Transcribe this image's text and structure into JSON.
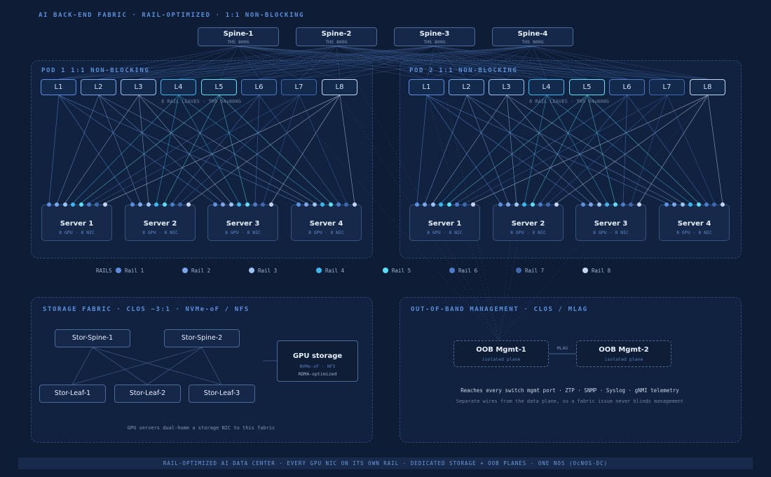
{
  "header": {
    "title": "AI BACK-END FABRIC · RAIL-OPTIMIZED · 1:1 NON-BLOCKING"
  },
  "spines": [
    {
      "name": "Spine-1",
      "model": "TH5 800G"
    },
    {
      "name": "Spine-2",
      "model": "TH5 800G"
    },
    {
      "name": "Spine-3",
      "model": "TH5 800G"
    },
    {
      "name": "Spine-4",
      "model": "TH5 800G"
    }
  ],
  "pods": [
    {
      "title": "POD 1 1:1 NON-BLOCKING",
      "caption": "8 RAIL LEAVES · TH5 64x800G",
      "leaves": [
        "L1",
        "L2",
        "L3",
        "L4",
        "L5",
        "L6",
        "L7",
        "L8"
      ],
      "servers": [
        {
          "name": "Server 1",
          "spec": "8 GPU · 8 NIC"
        },
        {
          "name": "Server 2",
          "spec": "8 GPU · 8 NIC"
        },
        {
          "name": "Server 3",
          "spec": "8 GPU · 8 NIC"
        },
        {
          "name": "Server 4",
          "spec": "8 GPU · 8 NIC"
        }
      ]
    },
    {
      "title": "POD 2 1:1 NON-BLOCKING",
      "caption": "8 RAIL LEAVES · TH5 64x800G",
      "leaves": [
        "L1",
        "L2",
        "L3",
        "L4",
        "L5",
        "L6",
        "L7",
        "L8"
      ],
      "servers": [
        {
          "name": "Server 1",
          "spec": "8 GPU · 8 NIC"
        },
        {
          "name": "Server 2",
          "spec": "8 GPU · 8 NIC"
        },
        {
          "name": "Server 3",
          "spec": "8 GPU · 8 NIC"
        },
        {
          "name": "Server 4",
          "spec": "8 GPU · 8 NIC"
        }
      ]
    }
  ],
  "legend": {
    "label": "RAILS",
    "rails": [
      {
        "name": "Rail 1",
        "color": "#5b8fe0"
      },
      {
        "name": "Rail 2",
        "color": "#7ba6ea"
      },
      {
        "name": "Rail 3",
        "color": "#9cc3f2"
      },
      {
        "name": "Rail 4",
        "color": "#3cb8ee"
      },
      {
        "name": "Rail 5",
        "color": "#5de0f5"
      },
      {
        "name": "Rail 6",
        "color": "#4c7cc9"
      },
      {
        "name": "Rail 7",
        "color": "#3d68ad"
      },
      {
        "name": "Rail 8",
        "color": "#c4d6f2"
      }
    ]
  },
  "storage": {
    "title": "STORAGE FABRIC · CLOS ~3:1 · NVMe-oF / NFS",
    "spines": [
      "Stor-Spine-1",
      "Stor-Spine-2"
    ],
    "leaves": [
      "Stor-Leaf-1",
      "Stor-Leaf-2",
      "Stor-Leaf-3"
    ],
    "gpu_storage": {
      "name": "GPU storage",
      "line1": "NVMe-oF · NFS",
      "line2": "RDMA-optimized"
    },
    "note": "GPU servers dual-home a storage NIC to this fabric"
  },
  "oob": {
    "title": "OUT-OF-BAND MANAGEMENT · CLOS / MLAG",
    "nodes": [
      {
        "name": "OOB Mgmt-1",
        "sub": "isolated plane"
      },
      {
        "name": "OOB Mgmt-2",
        "sub": "isolated plane"
      }
    ],
    "mlag_label": "MLAG",
    "line1": "Reaches every switch mgmt port · ZTP · SNMP · Syslog · gNMI telemetry",
    "line2": "Separate wires from the data plane, so a fabric issue never blinds management"
  },
  "footer": "RAIL-OPTIMIZED AI DATA CENTER · EVERY GPU NIC ON ITS OWN RAIL · DEDICATED STORAGE + OOB PLANES · ONE NOS (OcNOS-DC)"
}
